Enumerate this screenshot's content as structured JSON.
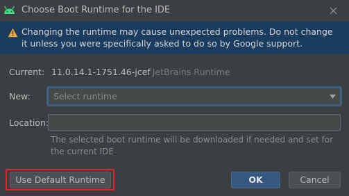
{
  "window": {
    "title": "Choose Boot Runtime for the IDE",
    "icon": "android-icon",
    "close_icon": "close-icon"
  },
  "banner": {
    "icon": "warning-icon",
    "text": "Changing the runtime may cause unexpected problems. Do not change it unless you were specifically asked to do so by Google support."
  },
  "current": {
    "label": "Current:",
    "version": "11.0.14.1-1751.46-jcef",
    "vendor": "JetBrains Runtime"
  },
  "new": {
    "label": "New:",
    "placeholder": "Select runtime",
    "arrow_icon": "dropdown-arrow-icon"
  },
  "location": {
    "label": "Location:",
    "value": "",
    "hint": "The selected boot runtime will be downloaded if needed and set for the current IDE"
  },
  "buttons": {
    "default_runtime": "Use Default Runtime",
    "ok": "OK",
    "cancel": "Cancel"
  },
  "colors": {
    "background": "#3c3f41",
    "banner": "#193c5f",
    "accent": "#365880",
    "highlight": "#e0242b",
    "android_green": "#3ddc84",
    "warning_yellow": "#f0a732"
  }
}
